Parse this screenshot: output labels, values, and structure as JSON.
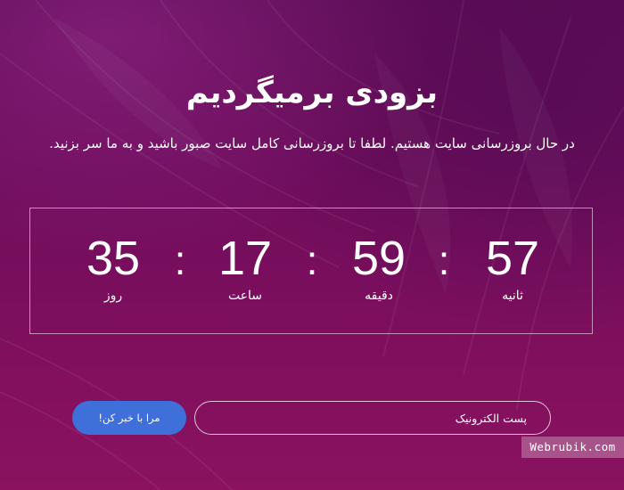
{
  "page": {
    "title": "بزودی برمیگردیم",
    "subtitle": "در حال بروزرسانی سایت هستیم. لطفا تا بروزرسانی کامل سایت صبور باشید و به ما سر بزنید."
  },
  "countdown": {
    "separator": ":",
    "seconds": {
      "value": "57",
      "label": "ثانیه"
    },
    "minutes": {
      "value": "59",
      "label": "دقیقه"
    },
    "hours": {
      "value": "17",
      "label": "ساعت"
    },
    "days": {
      "value": "35",
      "label": "روز"
    }
  },
  "subscribe": {
    "email_placeholder": "پست الکترونیک",
    "button_label": "مرا با خبر کن!"
  },
  "watermark": "Webrubik.com",
  "colors": {
    "background_top": "#5e0d56",
    "background_bottom": "#8a125f",
    "button": "#3f6fd8",
    "text": "#ffffff"
  }
}
